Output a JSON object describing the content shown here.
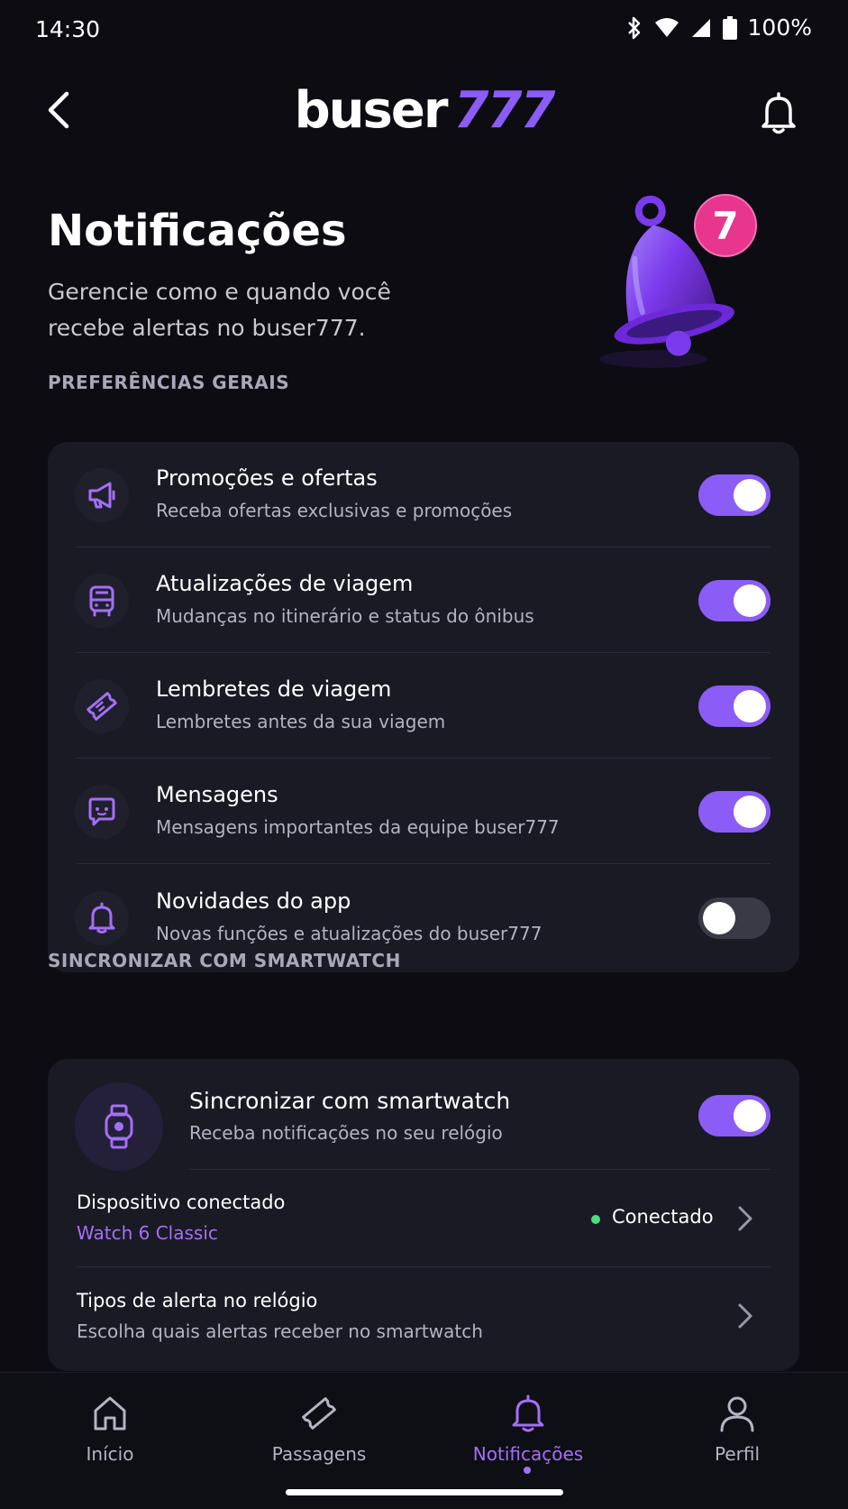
{
  "status_bar": {
    "time": "14:30",
    "battery": "100%"
  },
  "app_bar": {
    "logo_part1": "buser",
    "logo_part2": "777"
  },
  "hero": {
    "title": "Notificações",
    "subtitle": "Gerencie como e quando você recebe alertas no buser777.",
    "badge_count": "7"
  },
  "general": {
    "section_label": "PREFERÊNCIAS GERAIS",
    "items": [
      {
        "icon": "megaphone-icon",
        "title": "Promoções e ofertas",
        "subtitle": "Receba ofertas exclusivas e promoções",
        "enabled": true
      },
      {
        "icon": "bus-icon",
        "title": "Atualizações de viagem",
        "subtitle": "Mudanças no itinerário e status do ônibus",
        "enabled": true
      },
      {
        "icon": "ticket-icon",
        "title": "Lembretes de viagem",
        "subtitle": "Lembretes antes da sua viagem",
        "enabled": true
      },
      {
        "icon": "chat-icon",
        "title": "Mensagens",
        "subtitle": "Mensagens importantes da equipe buser777",
        "enabled": true
      },
      {
        "icon": "bell-icon",
        "title": "Novidades do app",
        "subtitle": "Novas funções e atualizações do buser777",
        "enabled": false
      }
    ]
  },
  "smartwatch": {
    "section_label": "SINCRONIZAR COM SMARTWATCH",
    "sync_title": "Sincronizar com smartwatch",
    "sync_subtitle": "Receba notificações no seu relógio",
    "sync_enabled": true,
    "device_label": "Dispositivo conectado",
    "device_name": "Watch 6 Classic",
    "device_status": "Conectado",
    "alerts_title": "Tipos de alerta no relógio",
    "alerts_subtitle": "Escolha quais alertas receber no smartwatch"
  },
  "bottom_nav": {
    "items": [
      {
        "label": "Início",
        "icon": "home-icon"
      },
      {
        "label": "Passagens",
        "icon": "ticket-icon"
      },
      {
        "label": "Notificações",
        "icon": "bell-icon",
        "active": true
      },
      {
        "label": "Perfil",
        "icon": "person-icon"
      }
    ]
  },
  "colors": {
    "accent": "#8b5cf6",
    "background": "#0c0c12",
    "card": "#1a1a24",
    "connected_dot": "#4ade80"
  }
}
